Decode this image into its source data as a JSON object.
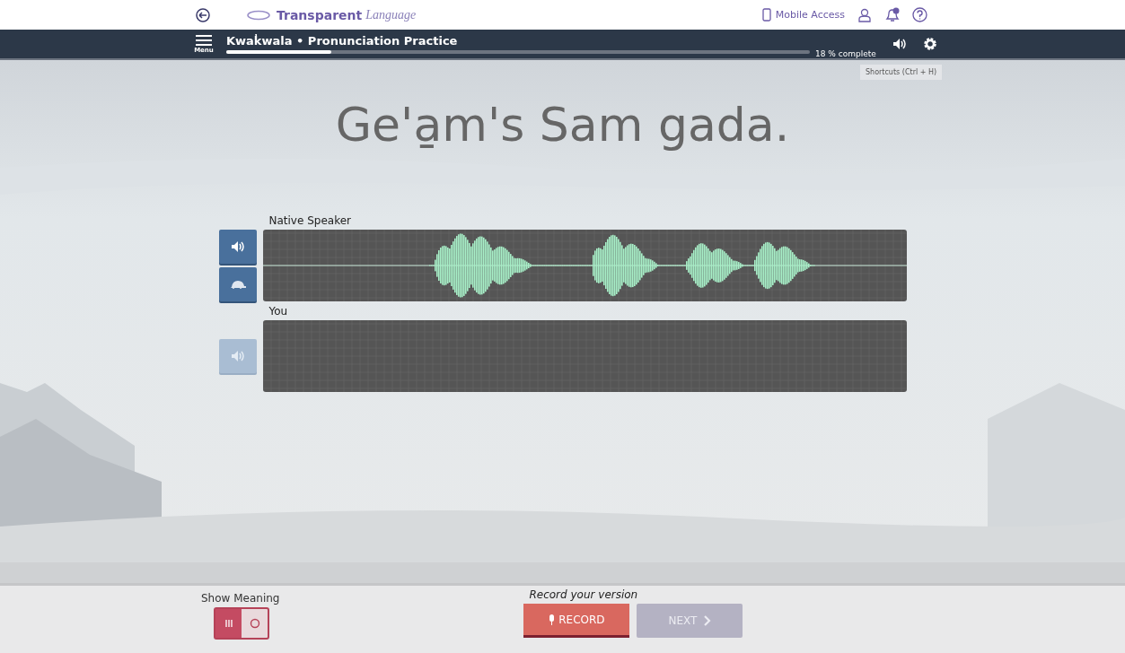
{
  "header": {
    "brand": {
      "bold": "Transparent",
      "italic": "Language"
    },
    "mobile_access": "Mobile Access"
  },
  "lesson_bar": {
    "menu_label": "Menu",
    "title": "Kwak̓wala • Pronunciation Practice",
    "progress": {
      "level": 0.18,
      "label": "18 % complete"
    },
    "tooltip": "Shortcuts (Ctrl + H)"
  },
  "phrase": "Ge'a̱m's Sam gada.",
  "tracks": [
    {
      "label": "Native Speaker",
      "has_audio": true,
      "slow_button": true
    },
    {
      "label": "You",
      "has_audio": false,
      "slow_button": false
    }
  ],
  "footer": {
    "show_meaning": {
      "label": "Show Meaning",
      "on": true
    },
    "record_hint": "Record your version",
    "record_button": "RECORD",
    "next_button": {
      "label": "NEXT",
      "disabled": true
    }
  }
}
